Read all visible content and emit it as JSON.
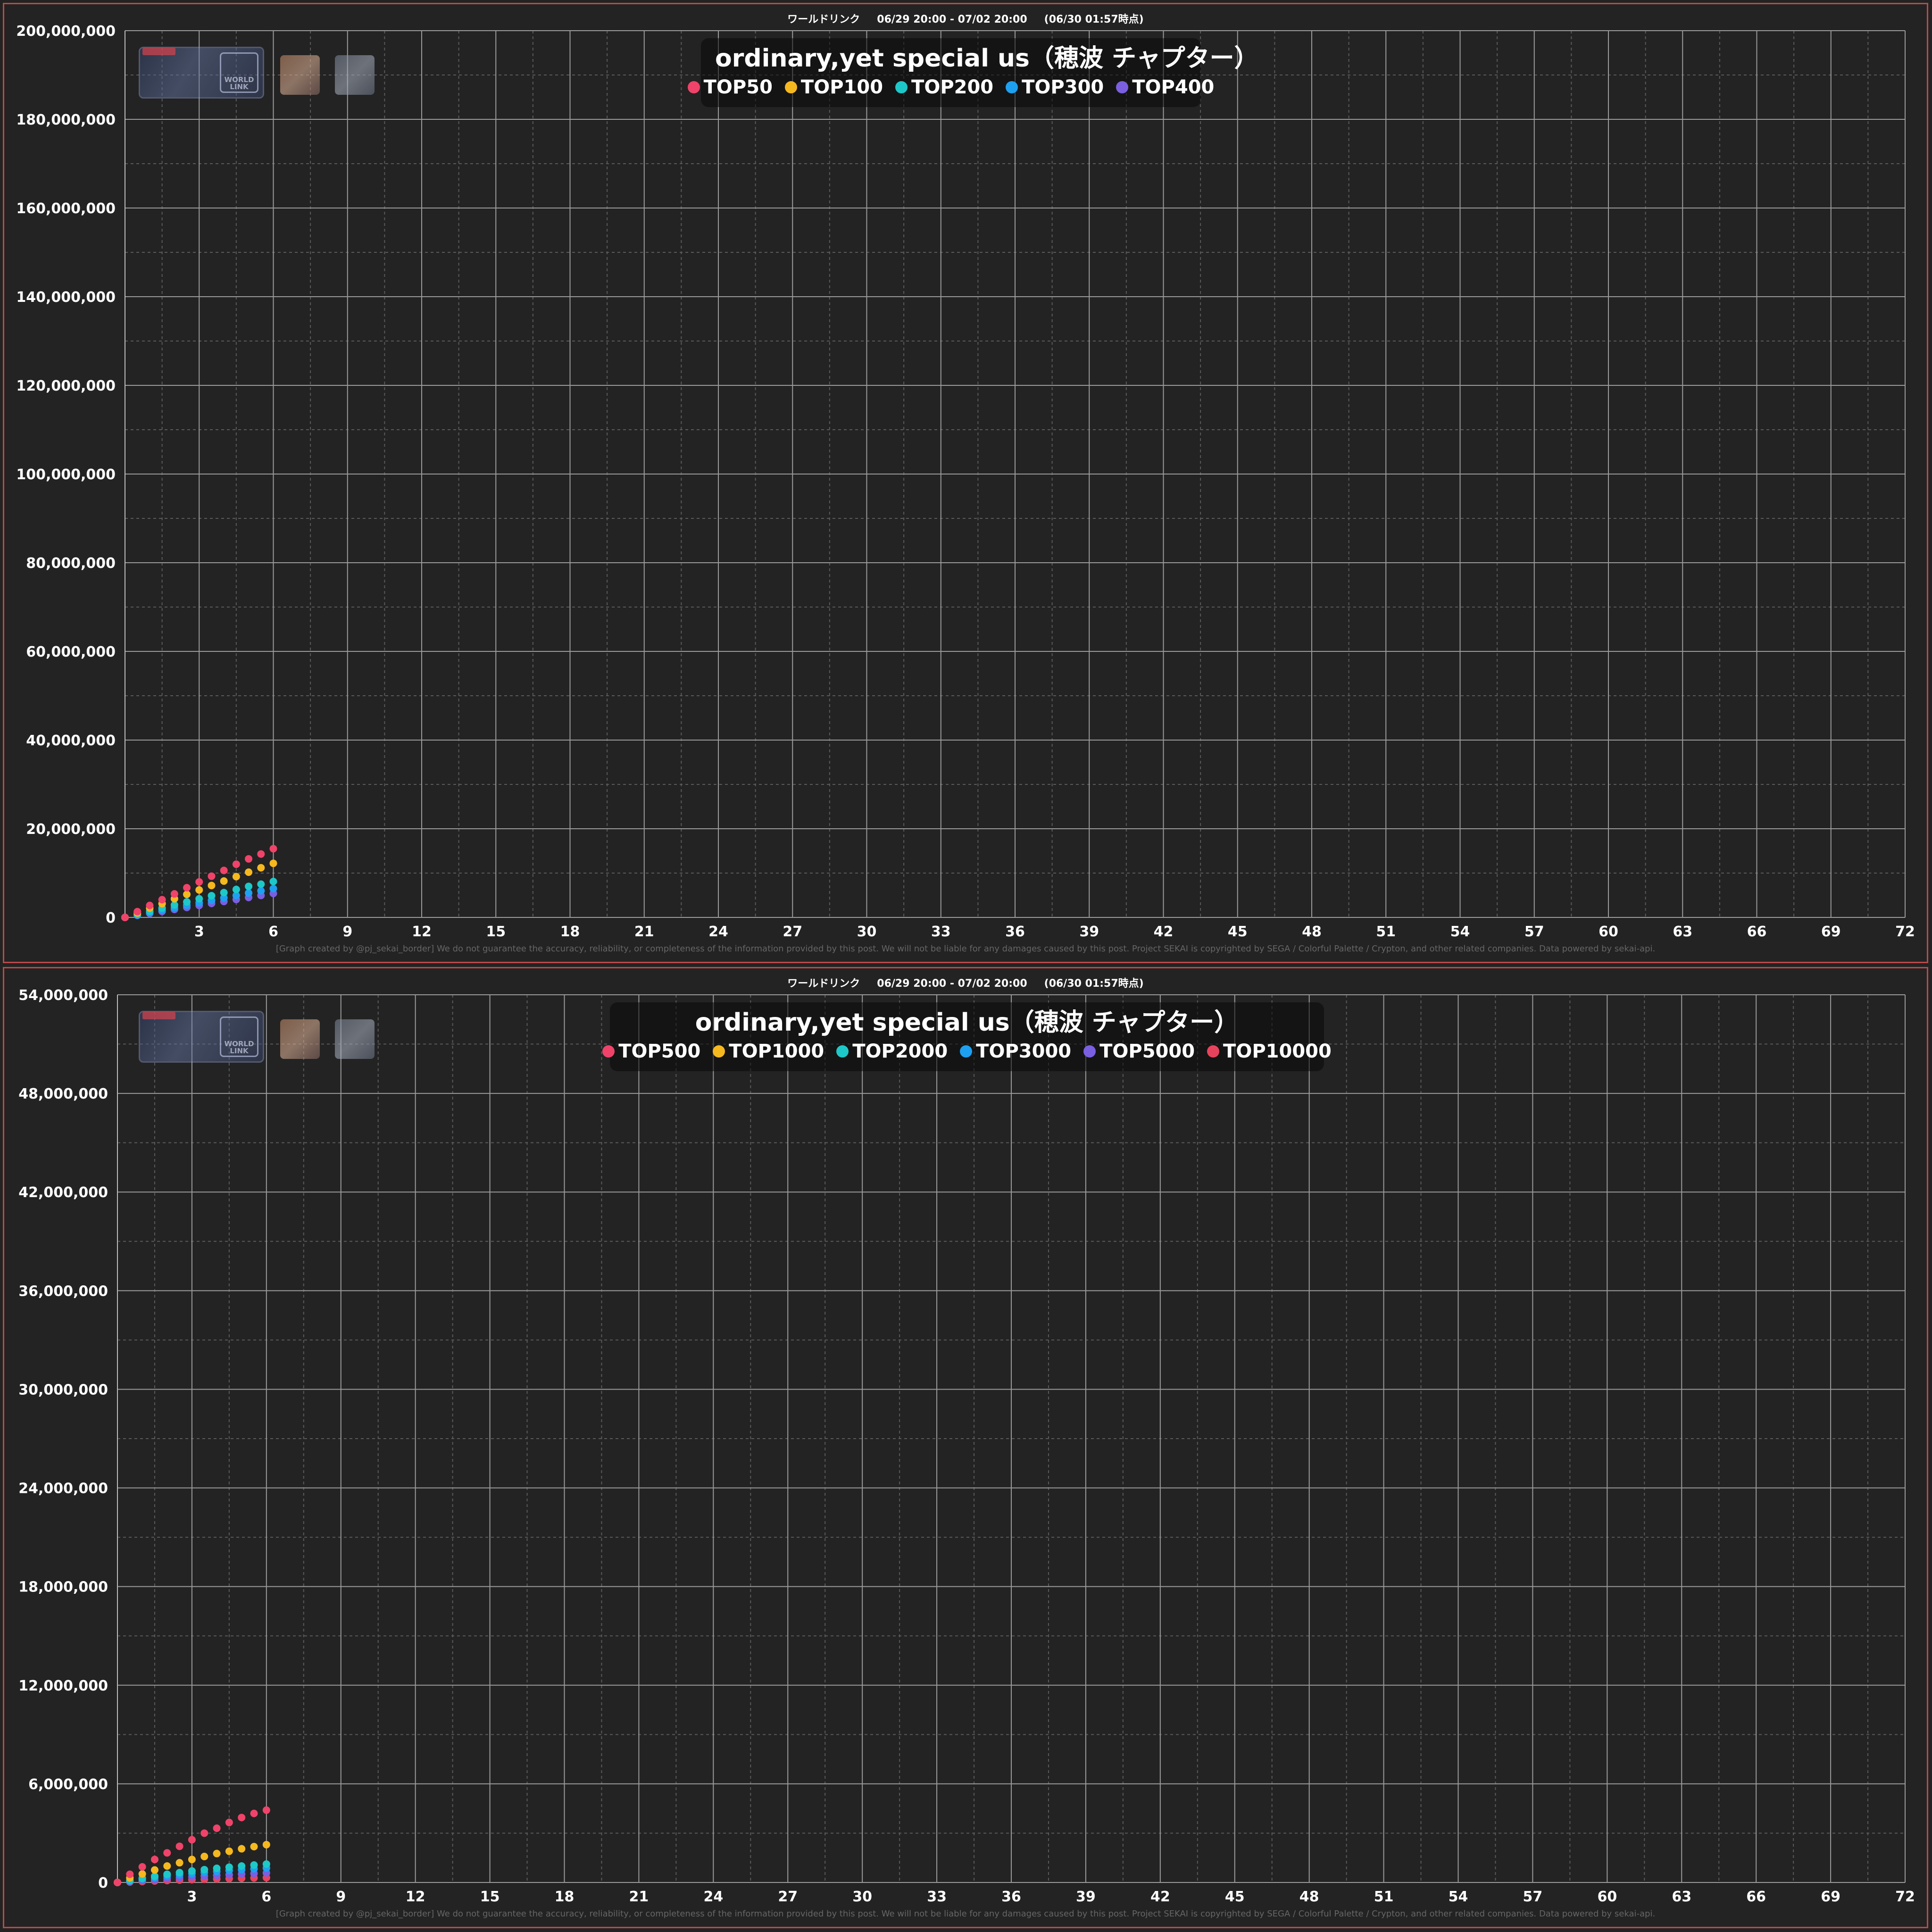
{
  "header": {
    "event": "ワールドリンク",
    "period": "06/29 20:00 - 07/02 20:00",
    "as_of": "(06/30 01:57時点)"
  },
  "footer_text": "[Graph created by @pj_sekai_border]  We do not guarantee the accuracy, reliability, or completeness of the information provided by this post. We will not be liable for any damages caused by this post. Project SEKAI is copyrighted by SEGA / Colorful Palette / Crypton, and other related companies. Data powered by sekai-api.",
  "logo_text": "WORLD LINK",
  "chart_data": [
    {
      "type": "scatter",
      "title": "ordinary,yet special us（穂波 チャプター）",
      "xlim": [
        0,
        72
      ],
      "ylim": [
        0,
        200000000
      ],
      "x_ticks": [
        3,
        6,
        9,
        12,
        15,
        18,
        21,
        24,
        27,
        30,
        33,
        36,
        39,
        42,
        45,
        48,
        51,
        54,
        57,
        60,
        63,
        66,
        69,
        72
      ],
      "y_ticks": [
        0,
        20000000,
        40000000,
        60000000,
        80000000,
        100000000,
        120000000,
        140000000,
        160000000,
        180000000,
        200000000
      ],
      "y_tick_labels": [
        "0",
        "20,000,000",
        "40,000,000",
        "60,000,000",
        "80,000,000",
        "100,000,000",
        "120,000,000",
        "140,000,000",
        "160,000,000",
        "180,000,000",
        "200,000,000"
      ],
      "grid": true,
      "legend_placement": "top-center",
      "x": [
        0,
        0.5,
        1,
        1.5,
        2,
        2.5,
        3,
        3.5,
        4,
        4.5,
        5,
        5.5,
        6
      ],
      "series": [
        {
          "name": "TOP50",
          "color": "#f0436a",
          "values": [
            0,
            1300000,
            2700000,
            4000000,
            5300000,
            6700000,
            8000000,
            9300000,
            10600000,
            12000000,
            13200000,
            14300000,
            15500000
          ]
        },
        {
          "name": "TOP100",
          "color": "#f5b81f",
          "values": [
            0,
            1000000,
            2100000,
            3100000,
            4200000,
            5200000,
            6200000,
            7200000,
            8200000,
            9200000,
            10200000,
            11200000,
            12200000
          ]
        },
        {
          "name": "TOP200",
          "color": "#1ec8c8",
          "values": [
            0,
            700000,
            1400000,
            2100000,
            2800000,
            3500000,
            4200000,
            4900000,
            5600000,
            6300000,
            7000000,
            7500000,
            8100000
          ]
        },
        {
          "name": "TOP300",
          "color": "#1ea0f0",
          "values": [
            0,
            550000,
            1100000,
            1650000,
            2200000,
            2750000,
            3300000,
            3850000,
            4400000,
            4950000,
            5500000,
            6000000,
            6500000
          ]
        },
        {
          "name": "TOP400",
          "color": "#7a5fe0",
          "values": [
            0,
            450000,
            900000,
            1350000,
            1800000,
            2250000,
            2700000,
            3150000,
            3600000,
            4050000,
            4500000,
            4950000,
            5400000
          ]
        }
      ]
    },
    {
      "type": "scatter",
      "title": "ordinary,yet special us（穂波 チャプター）",
      "xlim": [
        0,
        72
      ],
      "ylim": [
        0,
        54000000
      ],
      "x_ticks": [
        3,
        6,
        9,
        12,
        15,
        18,
        21,
        24,
        27,
        30,
        33,
        36,
        39,
        42,
        45,
        48,
        51,
        54,
        57,
        60,
        63,
        66,
        69,
        72
      ],
      "y_ticks": [
        0,
        6000000,
        12000000,
        18000000,
        24000000,
        30000000,
        36000000,
        42000000,
        48000000,
        54000000
      ],
      "y_tick_labels": [
        "0",
        "6,000,000",
        "12,000,000",
        "18,000,000",
        "24,000,000",
        "30,000,000",
        "36,000,000",
        "42,000,000",
        "48,000,000",
        "54,000,000"
      ],
      "grid": true,
      "legend_placement": "top-center",
      "x": [
        0,
        0.5,
        1,
        1.5,
        2,
        2.5,
        3,
        3.5,
        4,
        4.5,
        5,
        5.5,
        6
      ],
      "series": [
        {
          "name": "TOP500",
          "color": "#f0436a",
          "values": [
            0,
            500000,
            950000,
            1400000,
            1800000,
            2200000,
            2600000,
            3000000,
            3300000,
            3650000,
            3950000,
            4200000,
            4400000
          ]
        },
        {
          "name": "TOP1000",
          "color": "#f5b81f",
          "values": [
            0,
            280000,
            520000,
            760000,
            1000000,
            1200000,
            1400000,
            1580000,
            1760000,
            1900000,
            2050000,
            2180000,
            2300000
          ]
        },
        {
          "name": "TOP2000",
          "color": "#1ec8c8",
          "values": [
            0,
            130000,
            260000,
            380000,
            500000,
            600000,
            700000,
            780000,
            860000,
            930000,
            1000000,
            1060000,
            1120000
          ]
        },
        {
          "name": "TOP3000",
          "color": "#1ea0f0",
          "values": [
            0,
            100000,
            200000,
            300000,
            390000,
            470000,
            540000,
            610000,
            670000,
            730000,
            780000,
            830000,
            880000
          ]
        },
        {
          "name": "TOP5000",
          "color": "#7a5fe0",
          "values": [
            0,
            60000,
            120000,
            180000,
            240000,
            290000,
            340000,
            390000,
            430000,
            470000,
            510000,
            545000,
            580000
          ]
        },
        {
          "name": "TOP10000",
          "color": "#e8435c",
          "values": [
            0,
            30000,
            60000,
            90000,
            120000,
            145000,
            170000,
            195000,
            215000,
            235000,
            255000,
            275000,
            290000
          ]
        }
      ]
    }
  ]
}
